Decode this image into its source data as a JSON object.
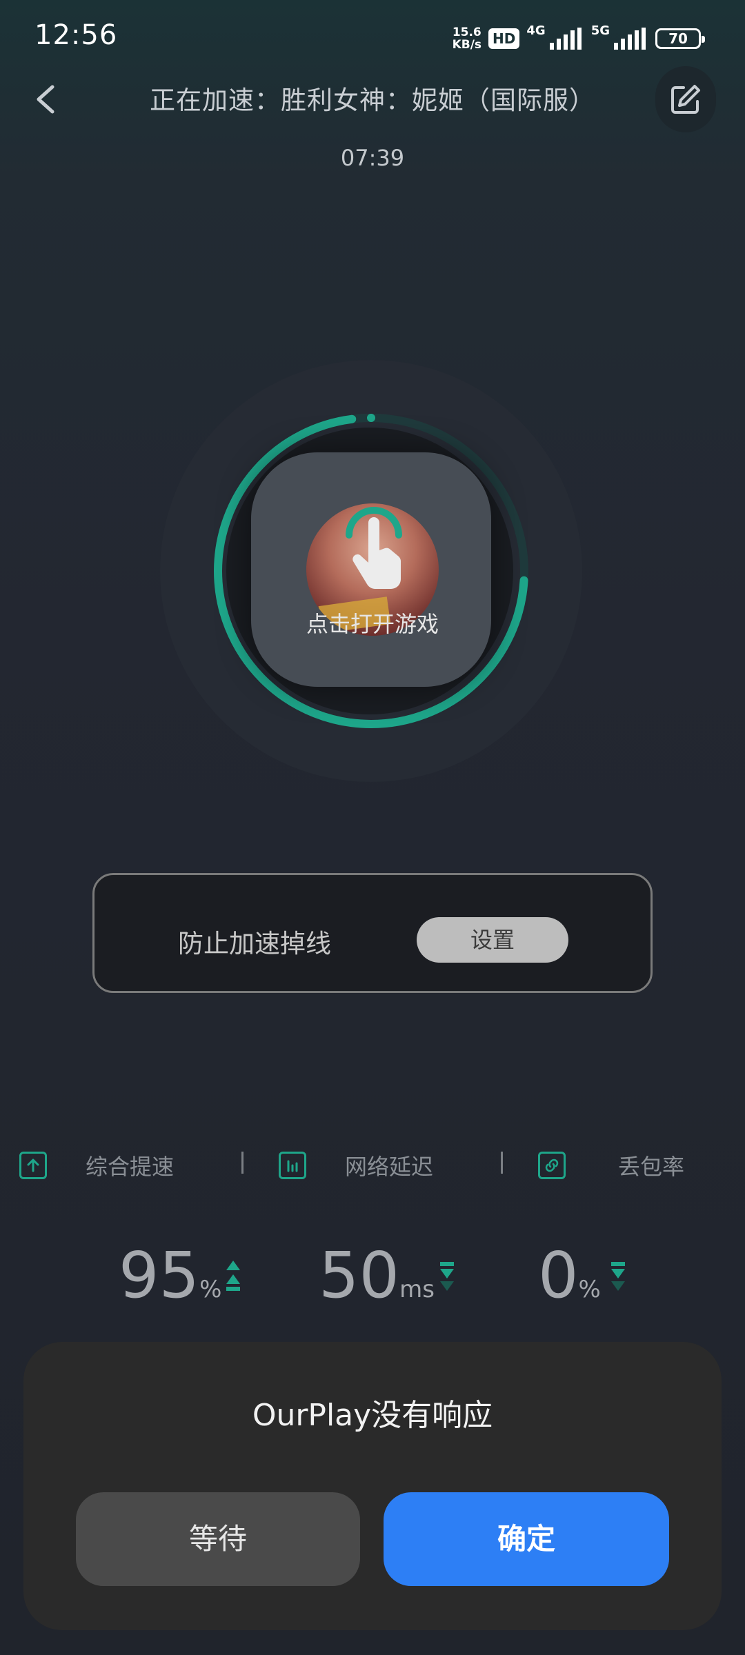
{
  "status_bar": {
    "time": "12:56",
    "net_speed_value": "15.6",
    "net_speed_unit": "KB/s",
    "hd_badge": "HD",
    "net_4g": "4G",
    "net_5g": "5G",
    "battery": "70"
  },
  "header": {
    "title": "正在加速：胜利女神：妮姬（国际服）",
    "timer": "07:39"
  },
  "booster": {
    "open_game_label": "点击打开游戏",
    "ring_color": "#1ea68a",
    "progress_fraction": 0.28
  },
  "anti_drop": {
    "label": "防止加速掉线",
    "settings_label": "设置"
  },
  "metrics": [
    {
      "label": "综合提速",
      "value": "95",
      "unit": "%",
      "trend": "up"
    },
    {
      "label": "网络延迟",
      "value": "50",
      "unit": "ms",
      "trend": "down"
    },
    {
      "label": "丢包率",
      "value": "0",
      "unit": "%",
      "trend": "down"
    }
  ],
  "dialog": {
    "title": "OurPlay没有响应",
    "wait_label": "等待",
    "ok_label": "确定",
    "ok_color": "#2d7ff5"
  }
}
